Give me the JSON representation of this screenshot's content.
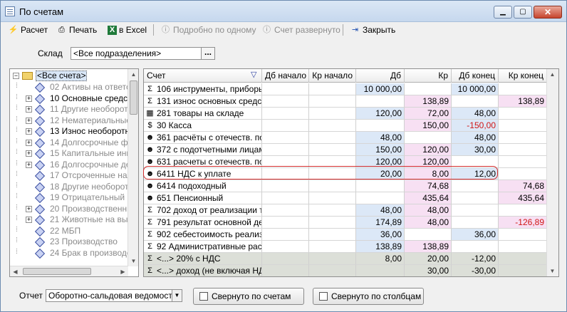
{
  "window": {
    "title": "По счетам",
    "minimize_label": "▁",
    "maximize_label": "▢",
    "close_label": "✕"
  },
  "toolbar": {
    "calc_label": "Расчет",
    "print_label": "Печать",
    "excel_label": "в Excel",
    "detail_label": "Подробно по одному",
    "expanded_label": "Счет развернуто",
    "close_label": "Закрыть"
  },
  "filter": {
    "warehouse_label": "Склад",
    "warehouse_value": "<Все подразделения>",
    "browse_label": "..."
  },
  "tree": {
    "root": "<Все счета>",
    "items": [
      {
        "code": "02",
        "label": "02 Активы на ответст",
        "gray": true,
        "expandable": false
      },
      {
        "code": "10",
        "label": "10 Основные средст",
        "gray": false,
        "expandable": true
      },
      {
        "code": "11",
        "label": "11 Другие необорот",
        "gray": true,
        "expandable": true
      },
      {
        "code": "12",
        "label": "12 Нематериальные",
        "gray": true,
        "expandable": true
      },
      {
        "code": "13",
        "label": "13 Износ необоротн",
        "gray": false,
        "expandable": true
      },
      {
        "code": "14",
        "label": "14 Долгосрочные фи",
        "gray": true,
        "expandable": true
      },
      {
        "code": "15",
        "label": "15 Капитальные инв",
        "gray": true,
        "expandable": true
      },
      {
        "code": "16",
        "label": "16 Долгосрочные де",
        "gray": true,
        "expandable": true
      },
      {
        "code": "17",
        "label": "17 Отсроченные нал",
        "gray": true,
        "expandable": false
      },
      {
        "code": "18",
        "label": "18 Другие необорот",
        "gray": true,
        "expandable": false
      },
      {
        "code": "19",
        "label": "19 Отрицательный гу",
        "gray": true,
        "expandable": false
      },
      {
        "code": "20",
        "label": "20 Производственны",
        "gray": true,
        "expandable": true
      },
      {
        "code": "21",
        "label": "21 Животные на выр",
        "gray": true,
        "expandable": true
      },
      {
        "code": "22",
        "label": "22 МБП",
        "gray": true,
        "expandable": false
      },
      {
        "code": "23",
        "label": "23 Производство",
        "gray": true,
        "expandable": false
      },
      {
        "code": "24",
        "label": "24 Брак в производс",
        "gray": true,
        "expandable": false
      }
    ]
  },
  "grid": {
    "headers": [
      "Счет",
      "Дб начало",
      "Кр начало",
      "Дб",
      "Кр",
      "Дб конец",
      "Кр конец"
    ],
    "rows": [
      {
        "icon": "sigma",
        "account": "106 инструменты, приборы",
        "db_start": "",
        "kr_start": "",
        "db": "10 000,00",
        "kr": "",
        "db_end": "10 000,00",
        "kr_end": ""
      },
      {
        "icon": "sigma",
        "account": "131 износ основных средст",
        "db_start": "",
        "kr_start": "",
        "db": "",
        "kr": "138,89",
        "db_end": "",
        "kr_end": "138,89"
      },
      {
        "icon": "goods",
        "account": "281 товары на складе",
        "db_start": "",
        "kr_start": "",
        "db": "120,00",
        "kr": "72,00",
        "db_end": "48,00",
        "kr_end": ""
      },
      {
        "icon": "cash",
        "account": "30 Касса",
        "db_start": "",
        "kr_start": "",
        "db": "",
        "kr": "150,00",
        "db_end": "-150,00",
        "kr_end": ""
      },
      {
        "icon": "person",
        "account": "361 расчёты с отечеств. по",
        "db_start": "",
        "kr_start": "",
        "db": "48,00",
        "kr": "",
        "db_end": "48,00",
        "kr_end": ""
      },
      {
        "icon": "person",
        "account": "372 с подотчетными лицам",
        "db_start": "",
        "kr_start": "",
        "db": "150,00",
        "kr": "120,00",
        "db_end": "30,00",
        "kr_end": ""
      },
      {
        "icon": "person",
        "account": "631 расчеты с отечеств. по",
        "db_start": "",
        "kr_start": "",
        "db": "120,00",
        "kr": "120,00",
        "db_end": "",
        "kr_end": ""
      },
      {
        "icon": "person",
        "account": "6411 НДС к уплате",
        "db_start": "",
        "kr_start": "",
        "db": "20,00",
        "kr": "8,00",
        "db_end": "12,00",
        "kr_end": ""
      },
      {
        "icon": "person",
        "account": "6414 подоходный",
        "db_start": "",
        "kr_start": "",
        "db": "",
        "kr": "74,68",
        "db_end": "",
        "kr_end": "74,68"
      },
      {
        "icon": "person",
        "account": "651 Пенсионный",
        "db_start": "",
        "kr_start": "",
        "db": "",
        "kr": "435,64",
        "db_end": "",
        "kr_end": "435,64"
      },
      {
        "icon": "sigma",
        "account": "702 доход от реализации т",
        "db_start": "",
        "kr_start": "",
        "db": "48,00",
        "kr": "48,00",
        "db_end": "",
        "kr_end": ""
      },
      {
        "icon": "sigma",
        "account": "791 результат основной де",
        "db_start": "",
        "kr_start": "",
        "db": "174,89",
        "kr": "48,00",
        "db_end": "",
        "kr_end": "-126,89"
      },
      {
        "icon": "sigma",
        "account": "902 себестоимость реализ",
        "db_start": "",
        "kr_start": "",
        "db": "36,00",
        "kr": "",
        "db_end": "36,00",
        "kr_end": ""
      },
      {
        "icon": "sigma",
        "account": "92 Административные рас",
        "db_start": "",
        "kr_start": "",
        "db": "138,89",
        "kr": "138,89",
        "db_end": "",
        "kr_end": ""
      }
    ],
    "totals": [
      {
        "account": "<...> 20% с НДС",
        "db": "8,00",
        "kr": "20,00",
        "db_end": "-12,00",
        "kr_end": ""
      },
      {
        "account": "<...> доход (не включая НД",
        "db": "",
        "kr": "30,00",
        "db_end": "-30,00",
        "kr_end": ""
      }
    ]
  },
  "footer": {
    "report_label": "Отчет",
    "report_value": "Оборотно-сальдовая ведомость",
    "collapse_accounts_label": "Свернуто по счетам",
    "collapse_columns_label": "Свернуто по столбцам"
  },
  "colors": {
    "debit_bg": "#dce8f7",
    "credit_bg": "#f7e0f3",
    "negative": "#d01616",
    "highlight": "#d42d2d"
  }
}
